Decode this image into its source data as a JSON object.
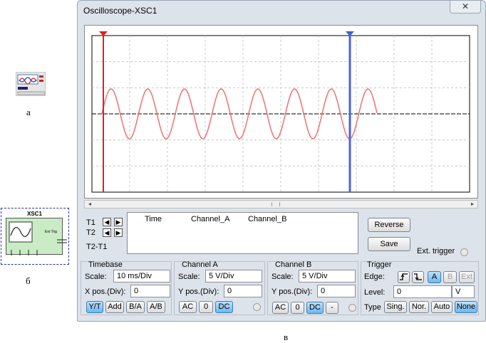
{
  "figure": {
    "label_a": "а",
    "label_b": "б",
    "label_c": "в",
    "symbol_title": "XSC1",
    "symbol_ext_trig": "Ext Trig"
  },
  "window": {
    "title": "Oscilloscope-XSC1",
    "close_glyph": "✕"
  },
  "readout": {
    "t1": "T1",
    "t2": "T2",
    "t2t1": "T2-T1",
    "col_time": "Time",
    "col_a": "Channel_A",
    "col_b": "Channel_B",
    "reverse": "Reverse",
    "save": "Save",
    "ext_trigger": "Ext. trigger"
  },
  "timebase": {
    "title": "Timebase",
    "scale_label": "Scale:",
    "scale_value": "10 ms/Div",
    "xpos_label": "X pos.(Div):",
    "xpos_value": "0",
    "buttons": [
      "Y/T",
      "Add",
      "B/A",
      "A/B"
    ]
  },
  "channel_a": {
    "title": "Channel A",
    "scale_label": "Scale:",
    "scale_value": "5  V/Div",
    "ypos_label": "Y pos.(Div):",
    "ypos_value": "0",
    "buttons": [
      "AC",
      "0",
      "DC"
    ]
  },
  "channel_b": {
    "title": "Channel B",
    "scale_label": "Scale:",
    "scale_value": "5  V/Div",
    "ypos_label": "Y pos.(Div):",
    "ypos_value": "0",
    "buttons": [
      "AC",
      "0",
      "DC",
      "-"
    ]
  },
  "trigger": {
    "title": "Trigger",
    "edge_label": "Edge:",
    "edge_buttons": [
      "A",
      "B",
      "Ext"
    ],
    "level_label": "Level:",
    "level_value": "0",
    "level_unit": "V",
    "type_label": "Type",
    "type_buttons": [
      "Sing.",
      "Nor.",
      "Auto",
      "None"
    ]
  },
  "colors": {
    "trace_a": "#f07070",
    "cursor1": "#e02020",
    "cursor2": "#3a5fd0",
    "selected_button": "#6db6ee",
    "window_bg": "#dde3ea"
  },
  "icons": {
    "edge_rising": "rising-edge-icon",
    "edge_falling": "falling-edge-icon",
    "cursor_left": "arrow-left-icon",
    "cursor_right": "arrow-right-icon"
  }
}
